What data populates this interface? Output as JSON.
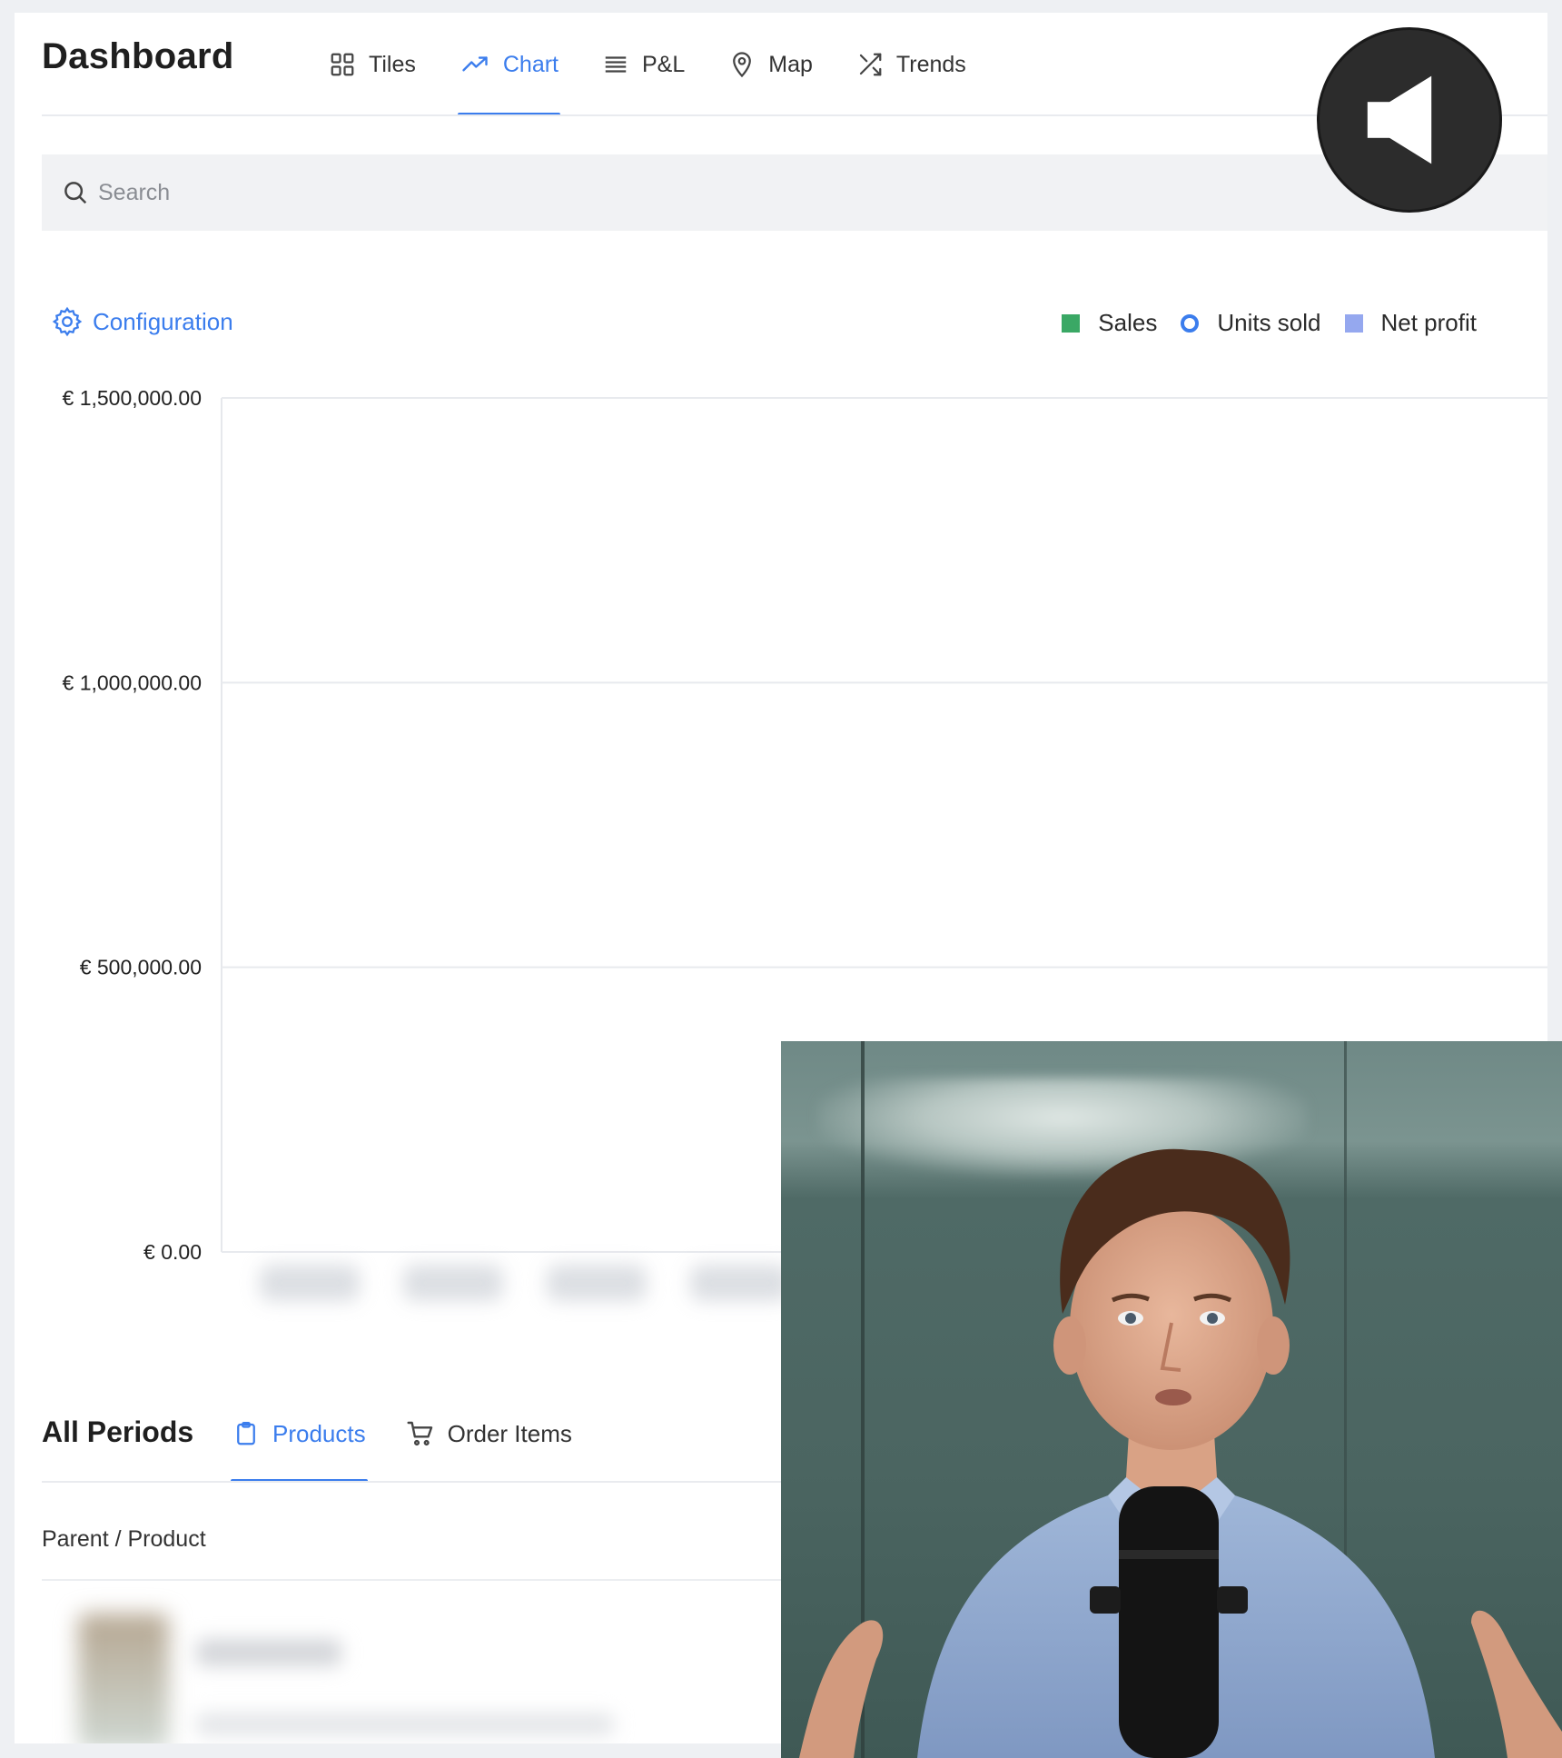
{
  "header": {
    "title": "Dashboard",
    "tabs": [
      {
        "label": "Tiles",
        "icon": "grid-icon",
        "active": false
      },
      {
        "label": "Chart",
        "icon": "trend-up-icon",
        "active": true
      },
      {
        "label": "P&L",
        "icon": "list-icon",
        "active": false
      },
      {
        "label": "Map",
        "icon": "map-pin-icon",
        "active": false
      },
      {
        "label": "Trends",
        "icon": "shuffle-icon",
        "active": false
      }
    ]
  },
  "search": {
    "placeholder": "Search"
  },
  "chart_controls": {
    "config_label": "Configuration",
    "legend": [
      {
        "label": "Sales",
        "marker": "square",
        "color": "#3aa865"
      },
      {
        "label": "Units sold",
        "marker": "ring",
        "color": "#3b7ded"
      },
      {
        "label": "Net profit",
        "marker": "square",
        "color": "#95a8ef"
      }
    ]
  },
  "chart_data": {
    "type": "bar",
    "categories": [],
    "series": [
      {
        "name": "Sales",
        "values": []
      },
      {
        "name": "Units sold",
        "values": []
      },
      {
        "name": "Net profit",
        "values": []
      }
    ],
    "yticks": [
      0,
      500000,
      1000000,
      1500000
    ],
    "ytick_labels": [
      "€ 0.00",
      "€ 500,000.00",
      "€ 1,000,000.00",
      "€ 1,500,000.00"
    ],
    "ylim": [
      0,
      1500000
    ],
    "grid": true,
    "legend_position": "top-right"
  },
  "lower": {
    "period_label": "All Periods",
    "tabs": [
      {
        "label": "Products",
        "icon": "clipboard-icon",
        "active": true
      },
      {
        "label": "Order Items",
        "icon": "cart-icon",
        "active": false
      }
    ],
    "column_header": "Parent / Product"
  },
  "colors": {
    "accent": "#3b7ded"
  }
}
